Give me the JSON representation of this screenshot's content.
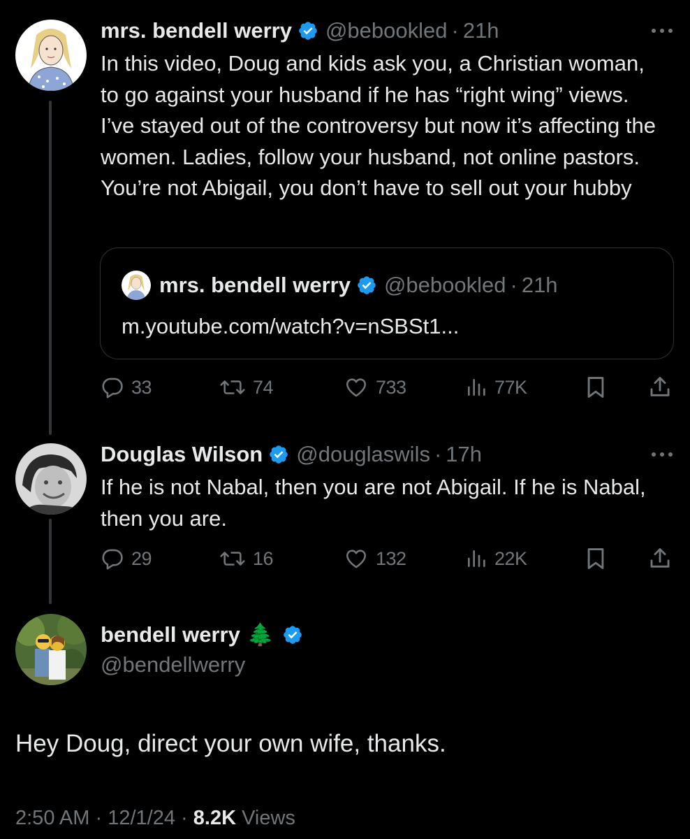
{
  "colors": {
    "background": "#000000",
    "text": "#e7e9ea",
    "secondary": "#71767b",
    "verified": "#1d9bf0",
    "border": "#2f3336"
  },
  "tweet1": {
    "name": "mrs. bendell werry",
    "handle": "@bebookled",
    "separator": "·",
    "time": "21h",
    "text": "In this video, Doug and kids ask you, a Christian woman, to go against your husband if he has “right wing” views. I’ve stayed out of the controversy but now it’s affecting the women. Ladies, follow your husband, not online pastors. You’re not Abigail, you don’t have to sell out your hubby",
    "quote": {
      "name": "mrs. bendell werry",
      "handle": "@bebookled",
      "separator": "·",
      "time": "21h",
      "text": "m.youtube.com/watch?v=nSBSt1..."
    },
    "stats": {
      "replies": "33",
      "retweets": "74",
      "likes": "733",
      "views": "77K"
    }
  },
  "tweet2": {
    "name": "Douglas Wilson",
    "handle": "@douglaswils",
    "separator": "·",
    "time": "17h",
    "text": "If he is not Nabal, then you are not Abigail. If he is Nabal, then you are.",
    "stats": {
      "replies": "29",
      "retweets": "16",
      "likes": "132",
      "views": "22K"
    }
  },
  "main_tweet": {
    "name": "bendell werry",
    "emoji": "🌲",
    "handle": "@bendellwerry",
    "text": "Hey Doug, direct your own wife, thanks.",
    "time": "2:50 AM",
    "date": "12/1/24",
    "separator": "·",
    "views_count": "8.2K",
    "views_label": "Views"
  }
}
